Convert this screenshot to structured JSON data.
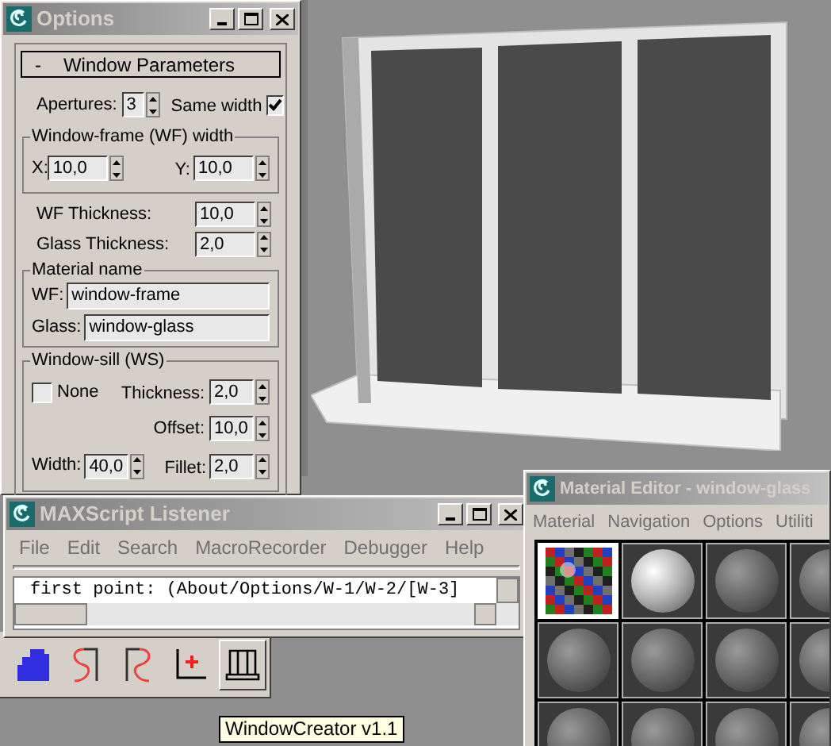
{
  "options_window": {
    "title": "Options",
    "rollout": {
      "toggle": "-",
      "title": "Window Parameters"
    },
    "apertures": {
      "label": "Apertures:",
      "value": "3"
    },
    "same_width": {
      "label": "Same width",
      "checked": true
    },
    "frame_width": {
      "title": "Window-frame (WF) width",
      "x": {
        "label": "X:",
        "value": "10,0"
      },
      "y": {
        "label": "Y:",
        "value": "10,0"
      }
    },
    "wf_thickness": {
      "label": "WF Thickness:",
      "value": "10,0"
    },
    "glass_thickness": {
      "label": "Glass Thickness:",
      "value": "2,0"
    },
    "material_name": {
      "title": "Material name",
      "wf": {
        "label": "WF:",
        "value": "window-frame"
      },
      "glass": {
        "label": "Glass:",
        "value": "window-glass"
      }
    },
    "window_sill": {
      "title": "Window-sill (WS)",
      "none": {
        "label": "None",
        "checked": false
      },
      "thickness": {
        "label": "Thickness:",
        "value": "2,0"
      },
      "offset": {
        "label": "Offset:",
        "value": "10,0"
      },
      "width": {
        "label": "Width:",
        "value": "40,0"
      },
      "fillet": {
        "label": "Fillet:",
        "value": "2,0"
      }
    }
  },
  "listener_window": {
    "title": "MAXScript Listener",
    "menu": [
      "File",
      "Edit",
      "Search",
      "MacroRecorder",
      "Debugger",
      "Help"
    ],
    "output": "first point: (About/Options/W-1/W-2/[W-3]"
  },
  "toolbar": {
    "buttons": [
      {
        "kind": "grid",
        "selected": false
      },
      {
        "kind": "curve-left",
        "selected": false
      },
      {
        "kind": "curve-right",
        "selected": false
      },
      {
        "kind": "axis",
        "selected": false
      },
      {
        "kind": "window",
        "selected": true
      }
    ]
  },
  "tooltip": "WindowCreator v1.1",
  "material_editor": {
    "title": "Material Editor - window-glass",
    "menu": [
      "Material",
      "Navigation",
      "Options",
      "Utiliti"
    ],
    "slots": [
      {
        "kind": "checker",
        "selected": true
      },
      {
        "kind": "bright",
        "selected": false
      },
      {
        "kind": "sphere",
        "selected": false
      },
      {
        "kind": "sphere",
        "selected": false
      },
      {
        "kind": "sphere",
        "selected": false
      },
      {
        "kind": "sphere",
        "selected": false
      },
      {
        "kind": "sphere",
        "selected": false
      },
      {
        "kind": "sphere",
        "selected": false
      },
      {
        "kind": "sphere",
        "selected": false
      },
      {
        "kind": "sphere",
        "selected": false
      },
      {
        "kind": "sphere",
        "selected": false
      },
      {
        "kind": "sphere",
        "selected": false
      }
    ]
  }
}
